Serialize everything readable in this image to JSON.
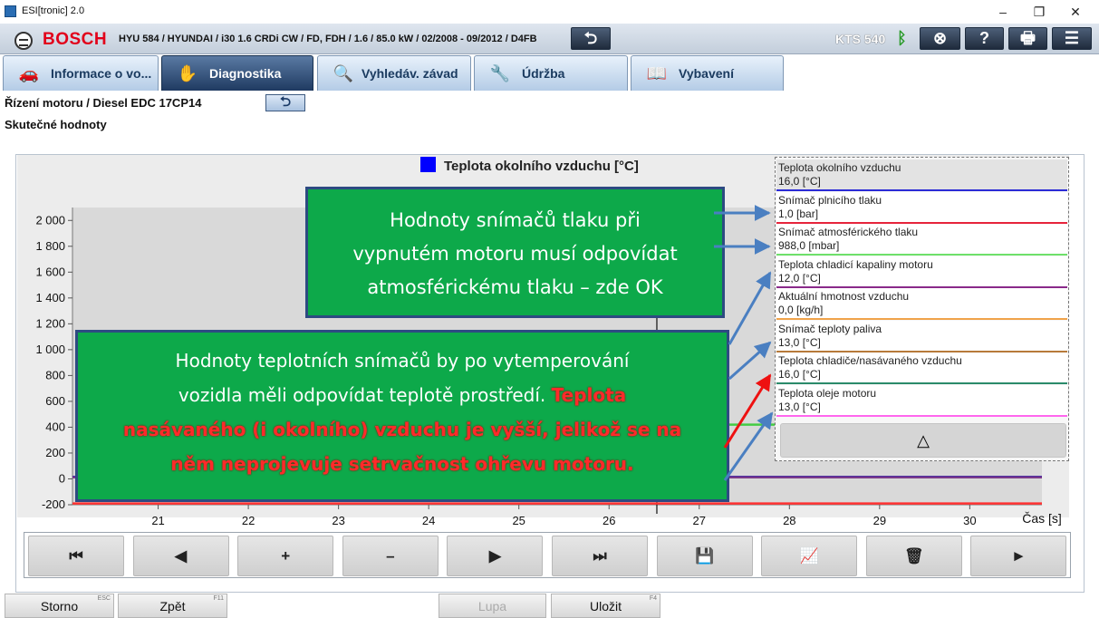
{
  "window": {
    "title": "ESI[tronic] 2.0",
    "controls": [
      "–",
      "❐",
      "✕"
    ]
  },
  "header": {
    "brand": "BOSCH",
    "vehicle": "HYU 584 / HYUNDAI / i30 1.6 CRDi CW / FD, FDH / 1.6 / 85.0 kW / 02/2008 - 09/2012 / D4FB",
    "device": "KTS 540",
    "back_glyph": "⮌",
    "help_glyph": "?",
    "bt_glyph": "ᛒ",
    "print_glyph": "🖶",
    "menu_glyph": "☰",
    "globe_glyph": "⊗"
  },
  "tabs": [
    {
      "label": "Informace o vo...",
      "icon": "🚗"
    },
    {
      "label": "Diagnostika",
      "icon": "✋"
    },
    {
      "label": "Vyhledáv. závad",
      "icon": "🔍"
    },
    {
      "label": "Údržba",
      "icon": "🔧"
    },
    {
      "label": "Vybavení",
      "icon": "📖"
    }
  ],
  "breadcrumb": {
    "path": "Řízení motoru / Diesel EDC 17CP14",
    "subtitle": "Skutečné hodnoty",
    "back_glyph": "⮌"
  },
  "chart_data": {
    "type": "line",
    "title": "Teplota okolního vzduchu [°C]",
    "title_color": "#0000ff",
    "xlabel": "Čas [s]",
    "ylabel": "",
    "x_ticks": [
      "21",
      "22",
      "23",
      "24",
      "25",
      "26",
      "27",
      "28",
      "29",
      "30"
    ],
    "y_ticks": [
      "2 000",
      "1 800",
      "1 600",
      "1 400",
      "1 200",
      "1 000",
      "800",
      "600",
      "400",
      "200",
      "0",
      "-200"
    ],
    "xlim": [
      20.05,
      30.8
    ],
    "ylim": [
      -200,
      2100
    ],
    "grid": false,
    "cursor_x": 26.53,
    "series": [
      {
        "name": "Teplota okolního vzduchu",
        "color": "#2222bb",
        "x": [
          20.05,
          30.8
        ],
        "values": [
          16.0,
          16.0
        ]
      },
      {
        "name": "Snímač plnicího tlaku",
        "color": "#ff3333",
        "x": [
          20.05,
          30.8
        ],
        "values": [
          -190,
          -190
        ]
      },
      {
        "name": "Snímač atmosférického tlaku",
        "color": "#44cc44",
        "x": [
          26.53,
          30.8
        ],
        "values": [
          420,
          420
        ]
      },
      {
        "name": "Teplota chladicí kapaliny motoru",
        "color": "#7a3a8a",
        "x": [
          20.05,
          30.8
        ],
        "values": [
          12.0,
          12.0
        ]
      }
    ]
  },
  "legend": {
    "items": [
      {
        "name": "Teplota okolního vzduchu",
        "value": "16,0 [°C]",
        "color": "#2b2bd6"
      },
      {
        "name": "Snímač plnicího tlaku",
        "value": "1,0 [bar]",
        "color": "#e6243b"
      },
      {
        "name": "Snímač atmosférického tlaku",
        "value": "988,0 [mbar]",
        "color": "#6ee06a"
      },
      {
        "name": "Teplota chladicí kapaliny motoru",
        "value": "12,0 [°C]",
        "color": "#8a2a8a"
      },
      {
        "name": "Aktuální hmotnost vzduchu",
        "value": "0,0 [kg/h]",
        "color": "#f0a34a"
      },
      {
        "name": "Snímač teploty paliva",
        "value": "13,0 [°C]",
        "color": "#b77a3a"
      },
      {
        "name": "Teplota chladiče/nasávaného vzduchu",
        "value": "16,0 [°C]",
        "color": "#2a8a6a"
      },
      {
        "name": "Teplota oleje motoru",
        "value": "13,0 [°C]",
        "color": "#ff66ee"
      }
    ],
    "scroll_up_glyph": "△"
  },
  "controls": [
    {
      "glyph": "⏮"
    },
    {
      "glyph": "◀"
    },
    {
      "glyph": "+"
    },
    {
      "glyph": "–"
    },
    {
      "glyph": "▶"
    },
    {
      "glyph": "⏭"
    },
    {
      "glyph": "💾"
    },
    {
      "glyph": "📈"
    },
    {
      "glyph": "🗑"
    },
    {
      "glyph": "►"
    }
  ],
  "footer": [
    {
      "label": "Storno",
      "key": "ESC",
      "enabled": true
    },
    {
      "label": "Zpět",
      "key": "F11",
      "enabled": true
    },
    {
      "label": "Lupa",
      "key": "",
      "enabled": false
    },
    {
      "label": "Uložit",
      "key": "F4",
      "enabled": true
    }
  ],
  "callouts": {
    "top_lines": [
      "Hodnoty snímačů tlaku při",
      "vypnutém motoru musí odpovídat",
      "atmosférickému tlaku – zde OK"
    ],
    "bottom_line1": "Hodnoty teplotních snímačů by po vytemperování",
    "bottom_line2_plain": "vozidla měli odpovídat teplotě prostředí. ",
    "bottom_line2_red": "Teplota",
    "bottom_red_line3": "nasávaného (i okolního) vzduchu je vyšší, jelikož se na",
    "bottom_red_line4": "něm neprojevuje setrvačnost ohřevu motoru."
  }
}
